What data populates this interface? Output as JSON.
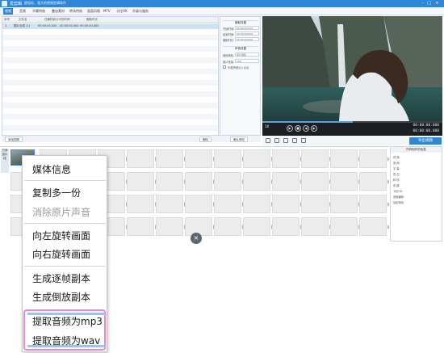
{
  "titlebar": {
    "app_name": "爱剪辑",
    "subtitle": "超轻松、强大的视频剪辑软件"
  },
  "menubar": {
    "tabs": [
      "视频",
      "音频",
      "字幕特效",
      "叠加素材",
      "转场特效",
      "画面风格",
      "MTV",
      "卡拉OK",
      "升级与服务"
    ]
  },
  "file_table": {
    "headers": [
      "序号",
      "文件名",
      "在最终影片中的时间",
      "截取时长"
    ],
    "selected_row": {
      "index": "1",
      "name": "图片合成 (1)",
      "time": "00:00:00.000 - 00:00:00.000",
      "duration": "00:00:00.000"
    }
  },
  "settings": {
    "section_clip": "截取设置",
    "start_label": "开始时间:",
    "start_value": "00:00:00.000",
    "end_label": "结束时间:",
    "end_value": "00:00:00.000",
    "dur_label": "截取时长:",
    "dur_value": "00:00:00.000",
    "section_audio": "声音设置",
    "track_label": "使用音轨:",
    "track_value": "原片音轨",
    "vol_label": "原片音量:",
    "vol_value": "100",
    "fade_label": "头尾声音淡入淡出",
    "confirm_button": "确认修改"
  },
  "preview": {
    "speed_label": "1X",
    "time_current": "00:00:00.000",
    "time_total": "00:00:00.000"
  },
  "toolbar": {
    "add_video": "添加视频",
    "delete": "删除",
    "confirm": "确认修改"
  },
  "export_button": "导出视频",
  "timeline": {
    "track_label": "已添加片段"
  },
  "info_panel": {
    "title": "所有制作的信息",
    "lines": [
      "视 频：",
      "音 频：",
      "字 幕：",
      "叠 加：",
      "转 场：",
      "风 格：",
      "卡拉OK：",
      "音频编辑：",
      "加贴特效："
    ]
  },
  "context_menu": {
    "items": [
      {
        "label": "媒体信息",
        "enabled": true
      },
      {
        "label": "复制多一份",
        "enabled": true
      },
      {
        "label": "消除原片声音",
        "enabled": false
      },
      {
        "label": "向左旋转画面",
        "enabled": true
      },
      {
        "label": "向右旋转画面",
        "enabled": true
      },
      {
        "label": "生成逐帧副本",
        "enabled": true
      },
      {
        "label": "生成倒放副本",
        "enabled": true
      },
      {
        "label": "提取音频为mp3",
        "enabled": true
      },
      {
        "label": "提取音频为wav",
        "enabled": true
      }
    ],
    "highlight_color": "#e58ccf"
  },
  "colors": {
    "accent": "#2f86d6"
  },
  "progress": {
    "fraction": 0.5
  }
}
